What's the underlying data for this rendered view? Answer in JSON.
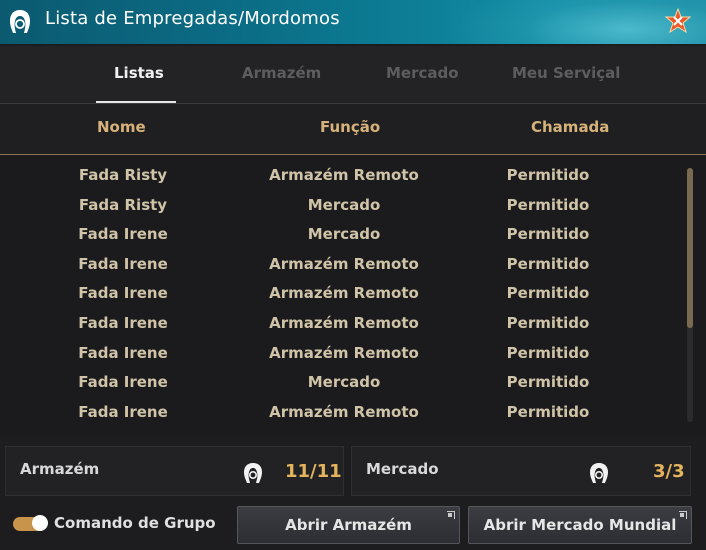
{
  "window": {
    "title": "Lista de Empregadas/Mordomos"
  },
  "tabs": [
    {
      "label": "Listas",
      "active": true
    },
    {
      "label": "Armazém",
      "active": false
    },
    {
      "label": "Mercado",
      "active": false
    },
    {
      "label": "Meu Serviçal",
      "active": false
    }
  ],
  "columns": {
    "name": "Nome",
    "function": "Função",
    "call": "Chamada"
  },
  "rows": [
    {
      "name": "Fada Risty",
      "function": "Armazém Remoto",
      "call": "Permitido"
    },
    {
      "name": "Fada Risty",
      "function": "Mercado",
      "call": "Permitido"
    },
    {
      "name": "Fada Irene",
      "function": "Mercado",
      "call": "Permitido"
    },
    {
      "name": "Fada Irene",
      "function": "Armazém Remoto",
      "call": "Permitido"
    },
    {
      "name": "Fada Irene",
      "function": "Armazém Remoto",
      "call": "Permitido"
    },
    {
      "name": "Fada Irene",
      "function": "Armazém Remoto",
      "call": "Permitido"
    },
    {
      "name": "Fada Irene",
      "function": "Armazém Remoto",
      "call": "Permitido"
    },
    {
      "name": "Fada Irene",
      "function": "Mercado",
      "call": "Permitido"
    },
    {
      "name": "Fada Irene",
      "function": "Armazém Remoto",
      "call": "Permitido"
    }
  ],
  "summary": {
    "warehouse": {
      "label": "Armazém",
      "count": "11/11",
      "icon": "maid-icon"
    },
    "market": {
      "label": "Mercado",
      "count": "3/3",
      "icon": "maid-icon"
    }
  },
  "footer": {
    "group_command": {
      "label": "Comando de Grupo",
      "enabled": true
    },
    "open_warehouse": "Abrir Armazém",
    "open_world_market": "Abrir Mercado Mundial"
  },
  "colors": {
    "accent": "#d6b27a",
    "count": "#e3b45c",
    "titlebar": "#0b6d86",
    "toggle": "#c8934a"
  }
}
